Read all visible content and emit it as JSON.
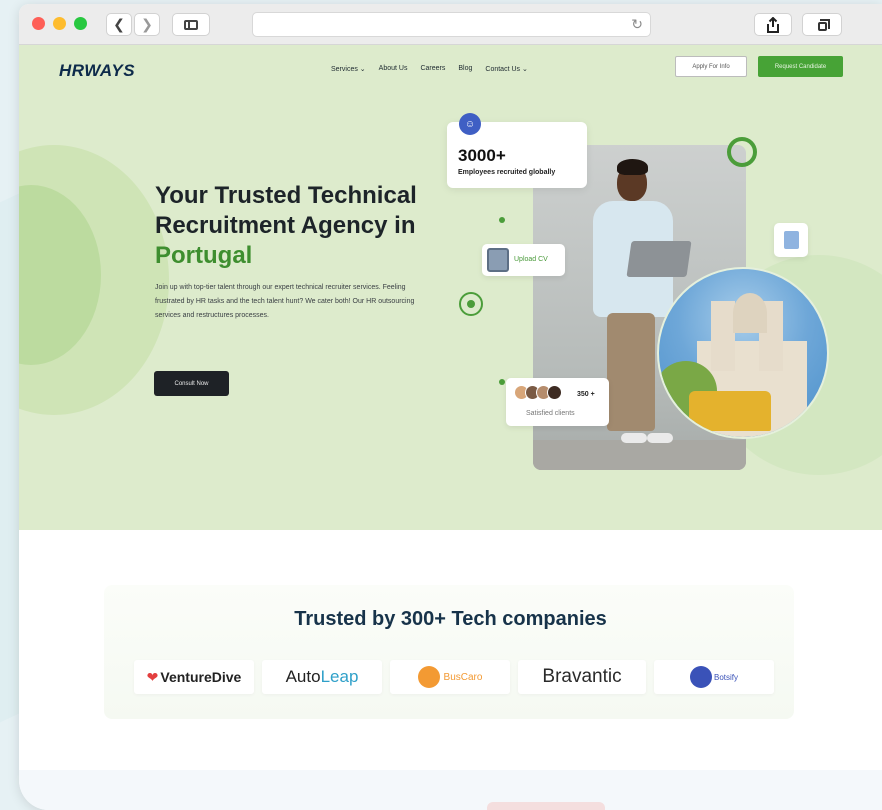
{
  "nav": {
    "logo": "HRWAYS",
    "items": [
      {
        "label": "Services",
        "has_dropdown": true
      },
      {
        "label": "About Us",
        "has_dropdown": false
      },
      {
        "label": "Careers",
        "has_dropdown": false
      },
      {
        "label": "Blog",
        "has_dropdown": false
      },
      {
        "label": "Contact Us",
        "has_dropdown": true
      }
    ],
    "apply_label": "Apply For Info",
    "request_label": "Request Candidate"
  },
  "hero": {
    "title_line1": "Your Trusted Technical",
    "title_line2": "Recruitment Agency in",
    "title_accent": "Portugal",
    "description": "Join up with top-tier talent through our expert technical recruiter services. Feeling frustrated by HR tasks and the tech talent hunt? We cater both! Our HR outsourcing services and restructures processes.",
    "cta_label": "Consult Now"
  },
  "stats": {
    "employees_value": "3000+",
    "employees_label": "Employees recruited globally",
    "upload_label": "Upload CV",
    "clients_value": "350 +",
    "clients_label": "Satisfied clients"
  },
  "trusted": {
    "title": "Trusted by 300+ Tech companies",
    "logos": {
      "venturedive": "VentureDive",
      "autoleap_a": "Auto",
      "autoleap_b": "Leap",
      "buscaro": "BusCaro",
      "bravantic": "Bravantic",
      "botsify": "Botsify"
    }
  },
  "colors": {
    "accent_green": "#47a336",
    "hero_bg": "#ddebcc",
    "title_navy": "#17334a"
  },
  "icons": [
    "back-arrow-icon",
    "forward-arrow-icon",
    "sidebar-icon",
    "reload-icon",
    "share-icon",
    "tabs-icon",
    "users-icon",
    "document-icon",
    "chevron-down-icon"
  ]
}
